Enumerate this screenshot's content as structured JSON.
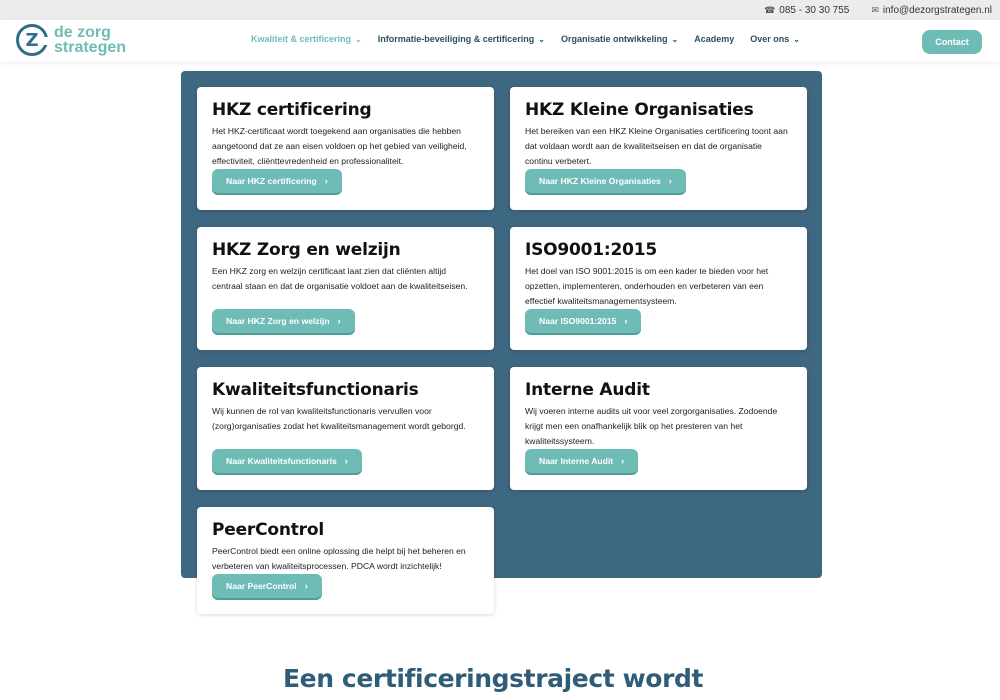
{
  "topbar": {
    "phone": "085 - 30 30 755",
    "phone_icon": "headset-icon",
    "email": "info@dezorgstrategen.nl",
    "email_icon": "envelope-icon"
  },
  "logo": {
    "mark": "Z",
    "line1": "de zorg",
    "line2": "strategen"
  },
  "menu": [
    {
      "label": "Kwaliteit & certificering",
      "active": true
    },
    {
      "label": "Informatie-beveiliging & certificering"
    },
    {
      "label": "Organisatie ontwikkeling"
    },
    {
      "label": "Academy"
    },
    {
      "label": "Over ons"
    }
  ],
  "contact_label": "Contact",
  "cards": [
    {
      "title": "HKZ certificering",
      "text": "Het HKZ-certificaat wordt toegekend aan organisaties die hebben aangetoond dat ze aan eisen voldoen op het gebied van veiligheid, effectiviteit, cliënttevredenheid en professionaliteit.",
      "button": "Naar HKZ certificering"
    },
    {
      "title": "HKZ Kleine Organisaties",
      "text": "Het bereiken van een HKZ Kleine Organisaties certificering toont aan dat voldaan wordt aan de kwaliteitseisen en dat de organisatie continu verbetert.",
      "button": "Naar HKZ Kleine Organisaties"
    },
    {
      "title": "HKZ Zorg en welzijn",
      "text": "Een HKZ zorg en welzijn certificaat laat zien dat cliënten altijd centraal staan en dat de organisatie voldoet aan de kwaliteitseisen.",
      "button": "Naar HKZ Zorg en welzijn"
    },
    {
      "title": "ISO9001:2015",
      "text": "Het doel van ISO 9001:2015 is om een kader te bieden voor het opzetten, implementeren, onderhouden en verbeteren van een effectief kwaliteitsmanagementsysteem.",
      "button": "Naar ISO9001:2015"
    },
    {
      "title": "Kwaliteitsfunctionaris",
      "text": "Wij kunnen de rol van kwaliteitsfunctionaris vervullen voor (zorg)organisaties zodat het kwaliteitsmanagement wordt geborgd.",
      "button": "Naar Kwaliteitsfunctionaris"
    },
    {
      "title": "Interne Audit",
      "text": "Wij voeren interne audits uit voor veel zorgorganisaties. Zodoende krijgt men een onafhankelijk blik op het presteren van het kwaliteitssysteem.",
      "button": "Naar Interne Audit"
    },
    {
      "title": "PeerControl",
      "text": "PeerControl biedt een online oplossing die helpt bij het beheren en verbeteren van kwaliteitsprocessen. PDCA wordt inzichtelijk!",
      "button": "Naar PeerControl"
    }
  ],
  "bottom_heading": "Een certificeringstraject wordt",
  "colors": {
    "accent": "#6fbcb6",
    "panel": "#3e6781",
    "heading": "#2f5d78"
  }
}
